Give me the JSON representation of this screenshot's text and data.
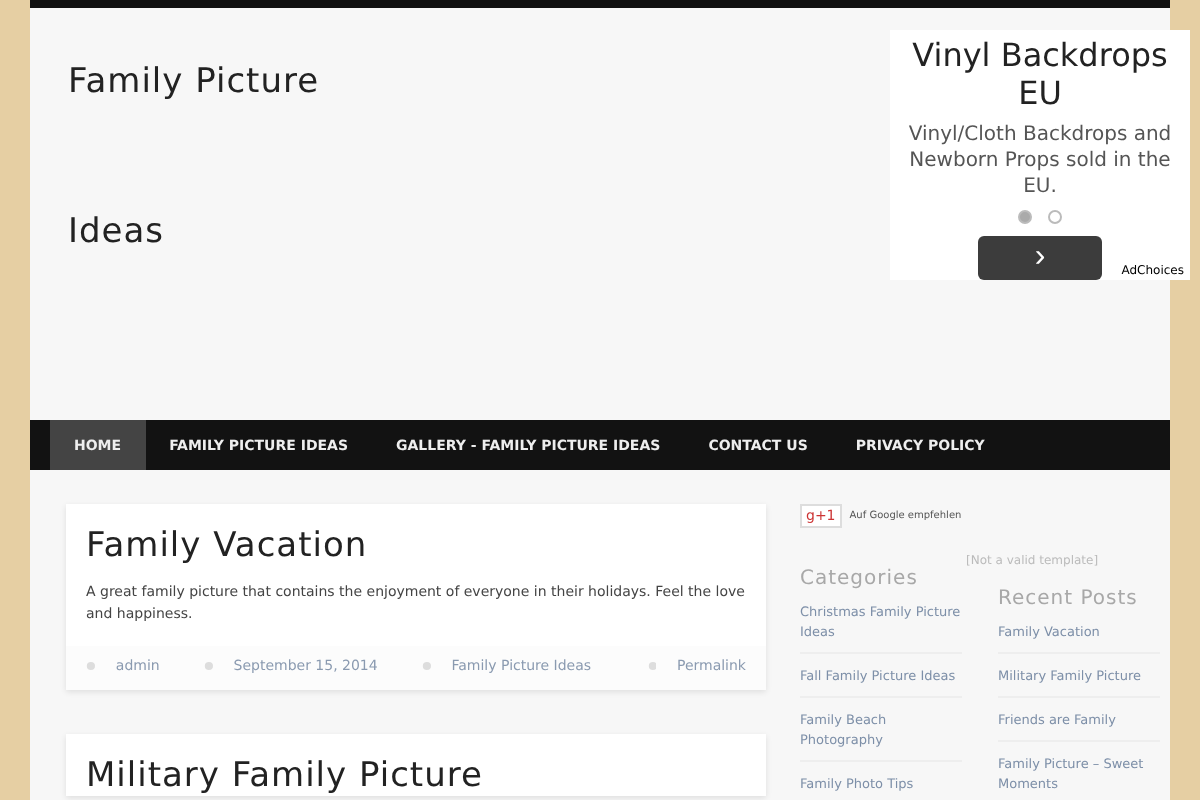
{
  "site_title": "Family Picture\n\n\nIdeas",
  "ad": {
    "headline": "Vinyl Backdrops EU",
    "text": "Vinyl/Cloth Backdrops and Newborn Props sold in the EU.",
    "dots": [
      {
        "selected": true
      },
      {
        "selected": false
      }
    ],
    "button": "›",
    "choices": "AdChoices"
  },
  "nav": [
    {
      "label": "HOME",
      "selected": true
    },
    {
      "label": "FAMILY PICTURE IDEAS",
      "selected": false
    },
    {
      "label": "GALLERY - FAMILY PICTURE IDEAS",
      "selected": false
    },
    {
      "label": "CONTACT US",
      "selected": false
    },
    {
      "label": "PRIVACY POLICY",
      "selected": false
    }
  ],
  "posts": [
    {
      "title": "Family Vacation",
      "excerpt": "A great family picture that contains the enjoyment of everyone in their holidays. Feel the love and happiness.",
      "author": "admin",
      "date": "September 15, 2014",
      "category": "Family Picture Ideas",
      "permalink": "Permalink"
    },
    {
      "title": "Military Family Picture"
    }
  ],
  "sidebar": {
    "gplus": "g+1",
    "gplus_label": "Auf Google empfehlen",
    "template_note": "[Not a valid template]",
    "categories": {
      "title": "Categories",
      "items": [
        "Christmas Family Picture Ideas",
        "Fall Family Picture Ideas",
        "Family Beach Photography",
        "Family Photo Tips"
      ]
    },
    "recent": {
      "title": "Recent Posts",
      "items": [
        "Family Vacation",
        "Military Family Picture",
        "Friends are Family",
        "Family Picture – Sweet Moments"
      ]
    }
  }
}
